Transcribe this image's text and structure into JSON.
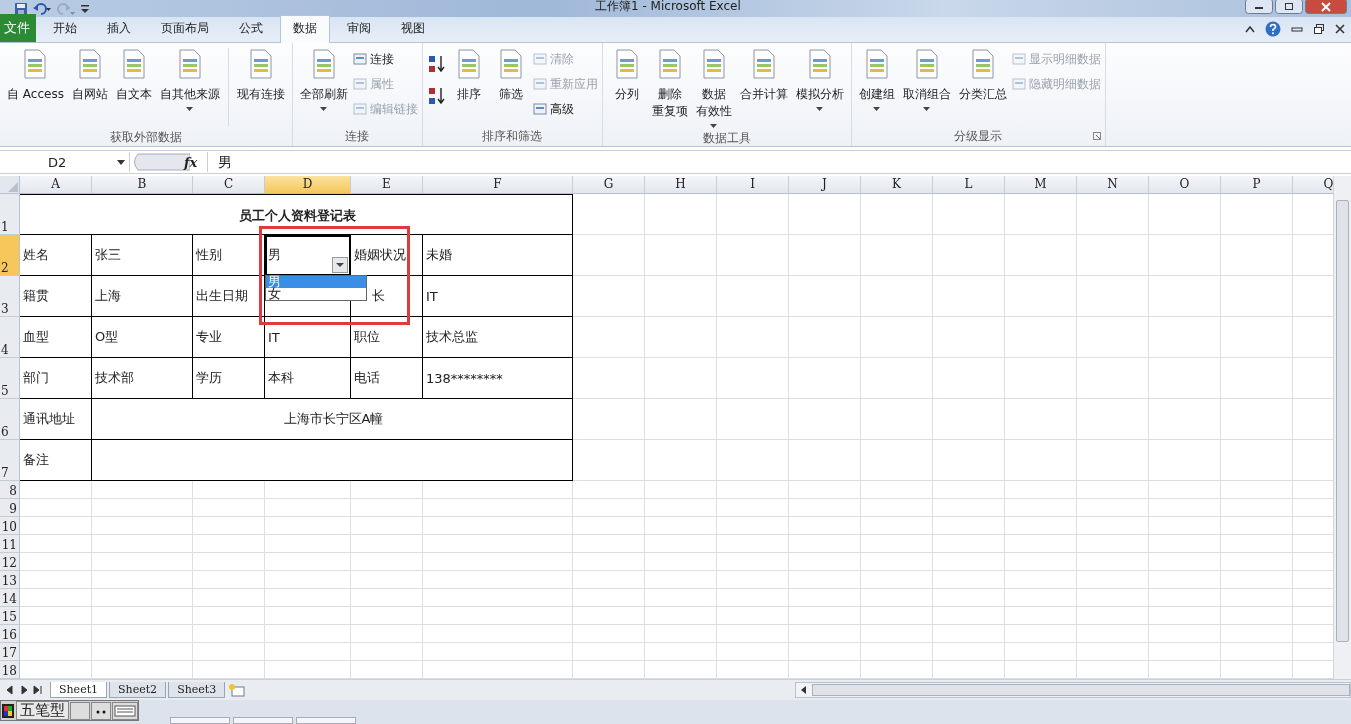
{
  "window": {
    "title": "工作簿1 - Microsoft Excel"
  },
  "tabs": [
    {
      "label": "文件",
      "kind": "file",
      "selected": false
    },
    {
      "label": "开始",
      "kind": "tab",
      "selected": false
    },
    {
      "label": "插入",
      "kind": "tab",
      "selected": false
    },
    {
      "label": "页面布局",
      "kind": "tab",
      "selected": false
    },
    {
      "label": "公式",
      "kind": "tab",
      "selected": false
    },
    {
      "label": "数据",
      "kind": "tab",
      "selected": true
    },
    {
      "label": "审阅",
      "kind": "tab",
      "selected": false
    },
    {
      "label": "视图",
      "kind": "tab",
      "selected": false
    }
  ],
  "ribbon": {
    "groups": [
      {
        "label": "获取外部数据",
        "launcher": false,
        "items": [
          {
            "kind": "large",
            "lines": [
              "自 Access"
            ],
            "dropdown": false,
            "disabled": false
          },
          {
            "kind": "large",
            "lines": [
              "自网站"
            ],
            "dropdown": false,
            "disabled": false
          },
          {
            "kind": "large",
            "lines": [
              "自文本"
            ],
            "dropdown": false,
            "disabled": false
          },
          {
            "kind": "large",
            "lines": [
              "自其他来源"
            ],
            "dropdown": true,
            "disabled": false
          },
          {
            "kind": "separator"
          },
          {
            "kind": "large",
            "lines": [
              "现有连接"
            ],
            "dropdown": false,
            "disabled": false
          }
        ]
      },
      {
        "label": "连接",
        "launcher": false,
        "items": [
          {
            "kind": "large",
            "lines": [
              "全部刷新"
            ],
            "dropdown": true,
            "disabled": false
          },
          {
            "kind": "stack",
            "items": [
              {
                "label": "连接",
                "disabled": false
              },
              {
                "label": "属性",
                "disabled": true
              },
              {
                "label": "编辑链接",
                "disabled": true
              }
            ]
          }
        ]
      },
      {
        "label": "排序和筛选",
        "launcher": false,
        "items": [
          {
            "kind": "sorts"
          },
          {
            "kind": "large",
            "lines": [
              "排序"
            ],
            "dropdown": false,
            "disabled": false
          },
          {
            "kind": "large",
            "lines": [
              "筛选"
            ],
            "dropdown": false,
            "disabled": false
          },
          {
            "kind": "stack",
            "items": [
              {
                "label": "清除",
                "disabled": true
              },
              {
                "label": "重新应用",
                "disabled": true
              },
              {
                "label": "高级",
                "disabled": false
              }
            ]
          }
        ]
      },
      {
        "label": "数据工具",
        "launcher": false,
        "items": [
          {
            "kind": "large",
            "lines": [
              "分列"
            ],
            "dropdown": false,
            "disabled": false
          },
          {
            "kind": "large",
            "lines": [
              "删除",
              "重复项"
            ],
            "dropdown": false,
            "disabled": false
          },
          {
            "kind": "large",
            "lines": [
              "数据",
              "有效性"
            ],
            "dropdown": true,
            "disabled": false
          },
          {
            "kind": "large",
            "lines": [
              "合并计算"
            ],
            "dropdown": false,
            "disabled": false
          },
          {
            "kind": "large",
            "lines": [
              "模拟分析"
            ],
            "dropdown": true,
            "disabled": false
          }
        ]
      },
      {
        "label": "分级显示",
        "launcher": true,
        "items": [
          {
            "kind": "large",
            "lines": [
              "创建组"
            ],
            "dropdown": true,
            "disabled": false
          },
          {
            "kind": "large",
            "lines": [
              "取消组合"
            ],
            "dropdown": true,
            "disabled": false
          },
          {
            "kind": "large",
            "lines": [
              "分类汇总"
            ],
            "dropdown": false,
            "disabled": false
          },
          {
            "kind": "stack",
            "items": [
              {
                "label": "显示明细数据",
                "disabled": true
              },
              {
                "label": "隐藏明细数据",
                "disabled": true
              }
            ]
          }
        ]
      }
    ]
  },
  "formula_bar": {
    "name_box": "D2",
    "fx": "fx",
    "value": "男"
  },
  "columns": [
    {
      "label": "A",
      "selected": false
    },
    {
      "label": "B",
      "selected": false
    },
    {
      "label": "C",
      "selected": false
    },
    {
      "label": "D",
      "selected": true
    },
    {
      "label": "E",
      "selected": false
    },
    {
      "label": "F",
      "selected": false
    },
    {
      "label": "G",
      "selected": false
    },
    {
      "label": "H",
      "selected": false
    },
    {
      "label": "I",
      "selected": false
    },
    {
      "label": "J",
      "selected": false
    },
    {
      "label": "K",
      "selected": false
    },
    {
      "label": "L",
      "selected": false
    },
    {
      "label": "M",
      "selected": false
    },
    {
      "label": "N",
      "selected": false
    },
    {
      "label": "O",
      "selected": false
    },
    {
      "label": "P",
      "selected": false
    },
    {
      "label": "Q",
      "selected": false
    }
  ],
  "row_numbers": [
    {
      "label": "1",
      "selected": false
    },
    {
      "label": "2",
      "selected": true
    },
    {
      "label": "3",
      "selected": false
    },
    {
      "label": "4",
      "selected": false
    },
    {
      "label": "5",
      "selected": false
    },
    {
      "label": "6",
      "selected": false
    },
    {
      "label": "7",
      "selected": false
    },
    {
      "label": "8",
      "selected": false
    },
    {
      "label": "9",
      "selected": false
    },
    {
      "label": "10",
      "selected": false
    },
    {
      "label": "11",
      "selected": false
    },
    {
      "label": "12",
      "selected": false
    },
    {
      "label": "13",
      "selected": false
    },
    {
      "label": "14",
      "selected": false
    },
    {
      "label": "15",
      "selected": false
    },
    {
      "label": "16",
      "selected": false
    },
    {
      "label": "17",
      "selected": false
    },
    {
      "label": "18",
      "selected": false
    }
  ],
  "table": {
    "title": "员工个人资料登记表",
    "rows": [
      {
        "cells": [
          {
            "text": "姓名",
            "selected": false
          },
          {
            "text": "张三",
            "selected": false
          },
          {
            "text": "性别",
            "selected": false
          },
          {
            "text": "男",
            "selected": true
          },
          {
            "text": "婚姻状况",
            "selected": false
          },
          {
            "text": "未婚",
            "selected": false
          }
        ]
      },
      {
        "cells": [
          {
            "text": "籍贯",
            "selected": false
          },
          {
            "text": "上海",
            "selected": false
          },
          {
            "text": "出生日期",
            "selected": false
          },
          {
            "selected": false
          },
          {
            "text": "长",
            "selected": false
          },
          {
            "text": "IT",
            "selected": false
          }
        ]
      },
      {
        "cells": [
          {
            "text": "血型",
            "selected": false
          },
          {
            "text": "O型",
            "selected": false
          },
          {
            "text": "专业",
            "selected": false
          },
          {
            "text": "IT",
            "selected": false
          },
          {
            "text": "职位",
            "selected": false
          },
          {
            "text": "技术总监",
            "selected": false
          }
        ]
      },
      {
        "cells": [
          {
            "text": "部门",
            "selected": false
          },
          {
            "text": "技术部",
            "selected": false
          },
          {
            "text": "学历",
            "selected": false
          },
          {
            "text": "本科",
            "selected": false
          },
          {
            "text": "电话",
            "selected": false
          },
          {
            "text": "138********",
            "selected": false
          }
        ]
      }
    ],
    "wide_rows": [
      {
        "label": "通讯地址",
        "value": "上海市长宁区A幢"
      },
      {
        "label": "备注"
      }
    ]
  },
  "dropdown": {
    "items": [
      {
        "label": "男",
        "selected": true
      },
      {
        "label": "女",
        "selected": false
      }
    ]
  },
  "sheet_tabs": [
    {
      "label": "Sheet1",
      "selected": true
    },
    {
      "label": "Sheet2",
      "selected": false
    },
    {
      "label": "Sheet3",
      "selected": false
    }
  ],
  "ime": {
    "mode": "五笔型"
  }
}
